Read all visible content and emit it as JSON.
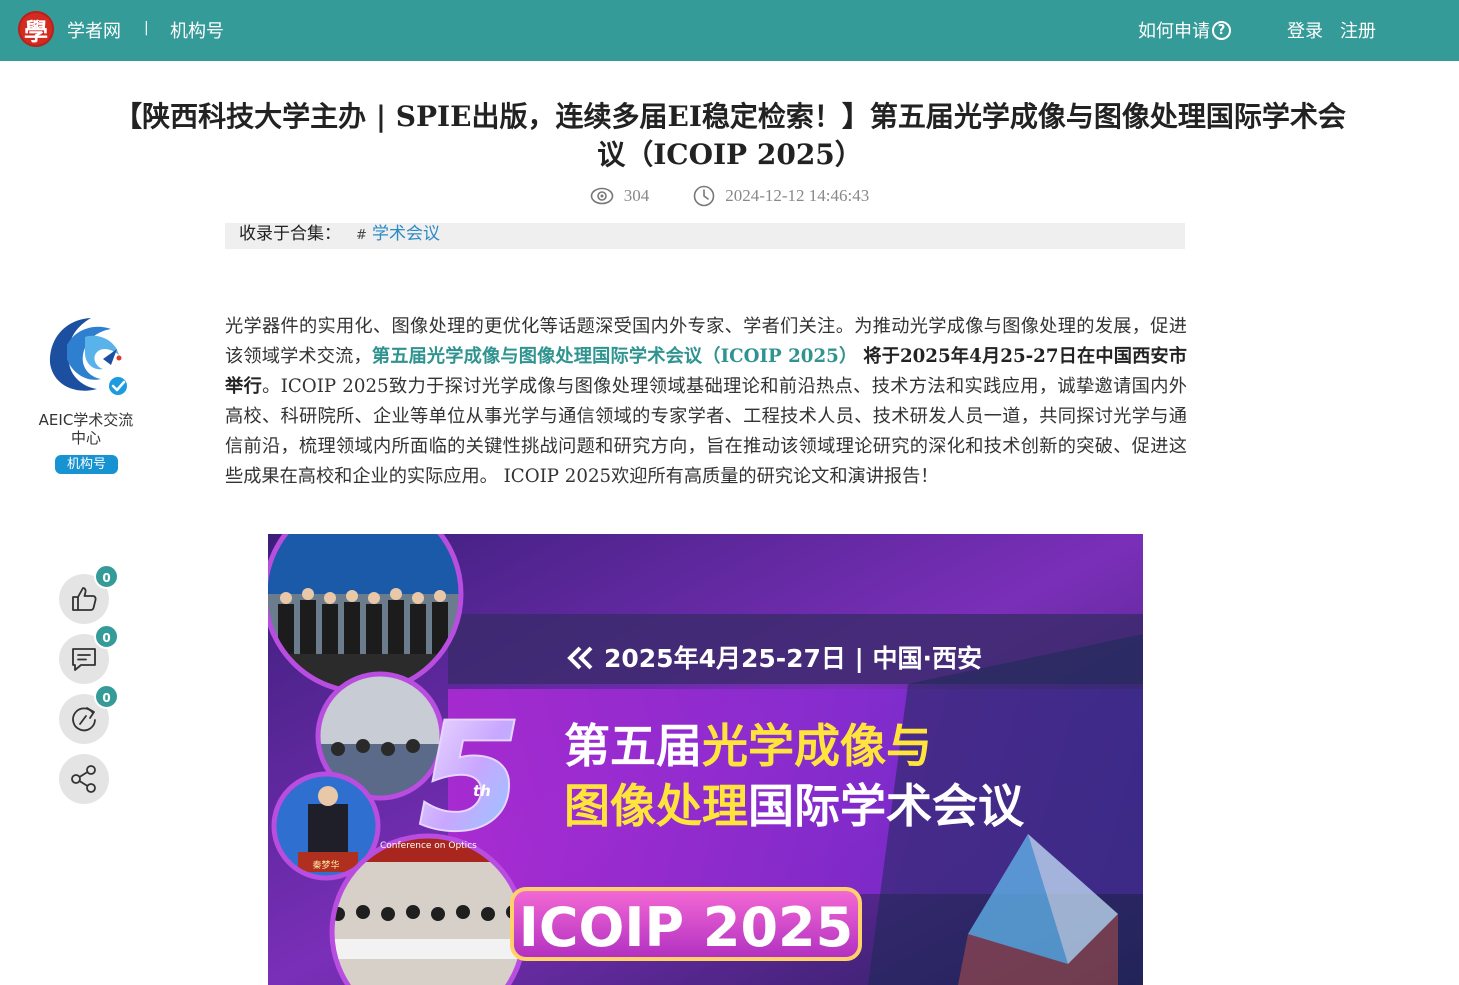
{
  "header": {
    "logo_glyph": "學",
    "site_name": "学者网",
    "separator": "|",
    "org_link": "机构号",
    "how_to_apply": "如何申请",
    "help_glyph": "?",
    "login": "登录",
    "register": "注册",
    "bar_color": "#359b98"
  },
  "article": {
    "title": "【陕西科技大学主办 | SPIE出版，连续多届EI稳定检索！】第五届光学成像与图像处理国际学术会议（ICOIP 2025）",
    "views": "304",
    "datetime": "2024-12-12 14:46:43",
    "collection_label": "收录于合集：",
    "collection_hash": "#",
    "collection_tag": "学术会议",
    "body_part1": "光学器件的实用化、图像处理的更优化等话题深受国内外专家、学者们关注。为推动光学成像与图像处理的发展，促进该领域学术交流，",
    "body_highlight": "第五届光学成像与图像处理国际学术会议（ICOIP 2025）",
    "body_bold": "将于2025年4月25-27日在中国西安市举行",
    "body_part2": "。ICOIP 2025致力于探讨光学成像与图像处理领域基础理论和前沿热点、技术方法和实践应用，诚挚邀请国内外高校、科研院所、企业等单位从事光学与通信领域的专家学者、工程技术人员、技术研发人员一道，共同探讨光学与通信前沿，梳理领域内所面临的关键性挑战问题和研究方向，旨在推动该领域理论研究的深化和技术创新的突破、促进这些成果在高校和企业的实际应用。 ICOIP 2025欢迎所有高质量的研究论文和演讲报告！"
  },
  "author": {
    "name": "AEIC学术交流中心",
    "badge": "机构号"
  },
  "actions": {
    "like_count": "0",
    "comment_count": "0",
    "repost_count": "0"
  },
  "banner": {
    "date_location": "2025年4月25-27日 | 中国·西安",
    "title_line1_white": "第五届",
    "title_line1_yellow": "光学成像与",
    "title_line2_yellow": "图像处理",
    "title_line2_white": "国际学术会议",
    "edition_number": "5",
    "edition_suffix": "th",
    "acronym": "ICOIP 2025",
    "photo_caption_text": "Conference on Optics",
    "speaker_nameplate": "秦梦华"
  }
}
